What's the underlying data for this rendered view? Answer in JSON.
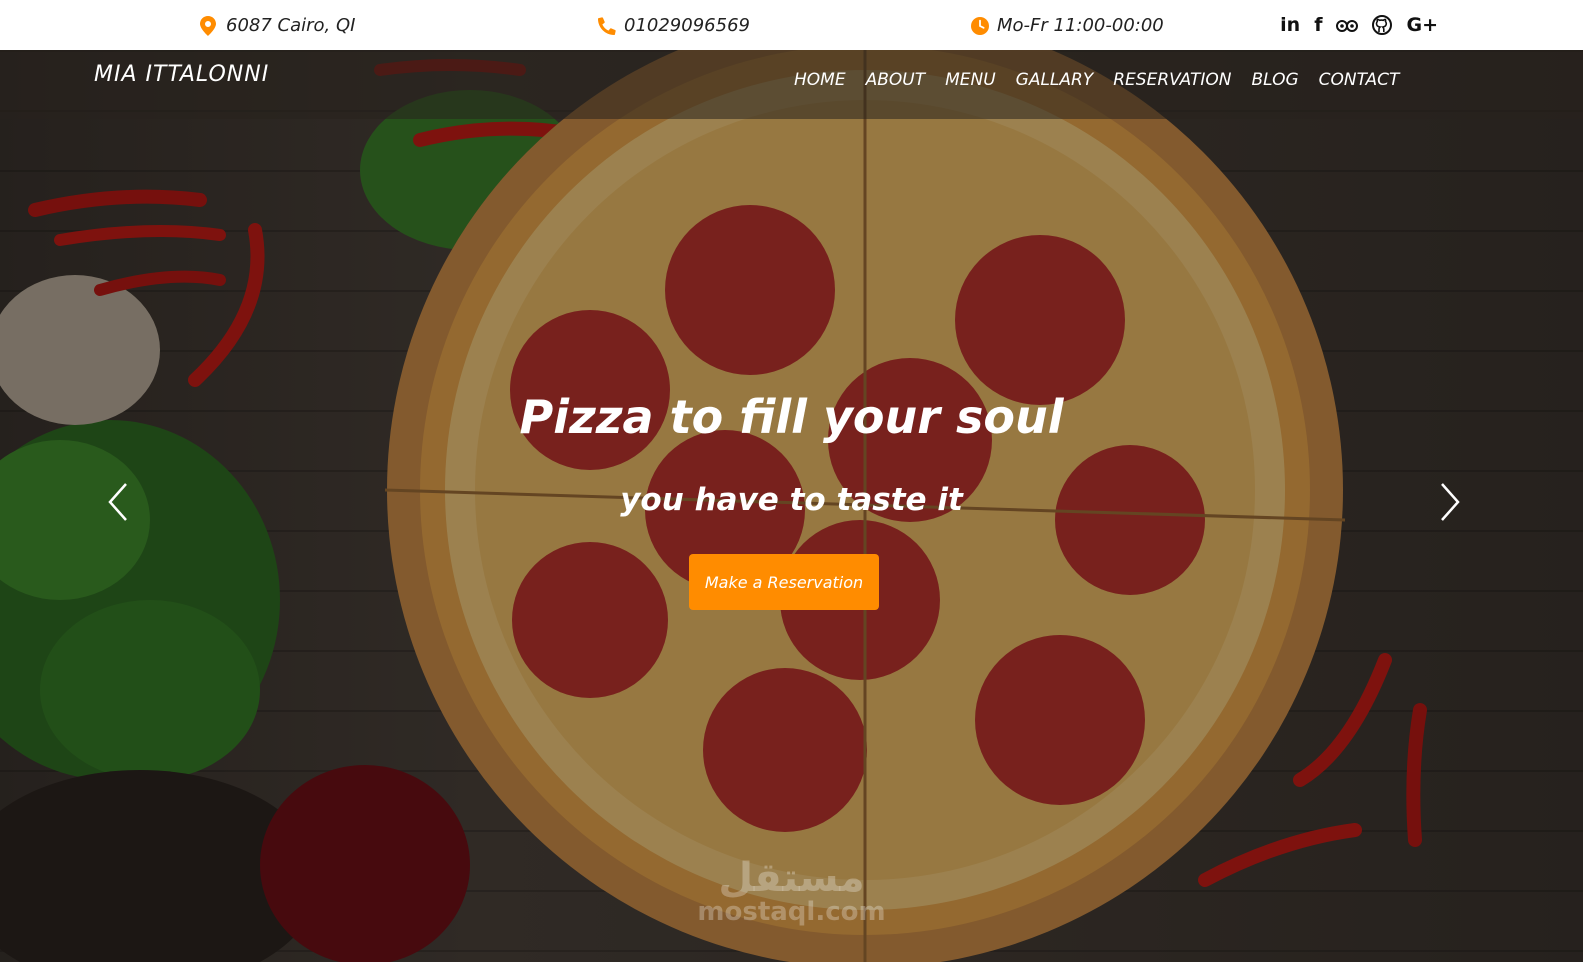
{
  "topbar": {
    "address": "6087 Cairo, QI",
    "phone": "01029096569",
    "hours": "Mo-Fr 11:00-00:00",
    "socials": [
      "in",
      "f",
      "G+"
    ],
    "accent_color": "#ff8c00"
  },
  "navbar": {
    "brand": "MIA ITTALONNI",
    "items": [
      "HOME",
      "ABOUT",
      "MENU",
      "GALLARY",
      "RESERVATION",
      "BLOG",
      "CONTACT"
    ]
  },
  "hero": {
    "title": "Pizza to fill your soul",
    "subtitle": "you have to taste it",
    "cta_label": "Make a Reservation",
    "cta_color": "#ff8c00",
    "prev_icon": "chevron-left-icon",
    "next_icon": "chevron-right-icon"
  },
  "watermark": {
    "arabic": "مستقل",
    "latin": "mostaql.com"
  }
}
